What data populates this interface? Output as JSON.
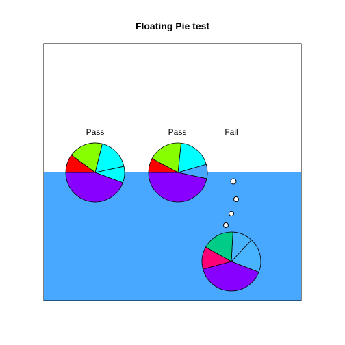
{
  "chart_data": {
    "type": "pie",
    "title": "Floating Pie test",
    "colors": {
      "water": "#48a8ff",
      "background": "#ffffff",
      "frame": "#000000",
      "bubble_fill": "#ffffff"
    },
    "pies": [
      {
        "label": "Pass",
        "state": "floating",
        "slices": [
          {
            "value": 40,
            "color": "#8800ff"
          },
          {
            "value": 8,
            "color": "#00ffff"
          },
          {
            "value": 16,
            "color": "#00ffff"
          },
          {
            "value": 17,
            "color": "#88ff00"
          },
          {
            "value": 9,
            "color": "#ff0000"
          }
        ]
      },
      {
        "label": "Pass",
        "state": "floating",
        "slices": [
          {
            "value": 42,
            "color": "#8800ff"
          },
          {
            "value": 7,
            "color": "#48a8ff"
          },
          {
            "value": 17,
            "color": "#00ffff"
          },
          {
            "value": 17,
            "color": "#88ff00"
          },
          {
            "value": 7,
            "color": "#ff0000"
          }
        ]
      },
      {
        "label": "Fail",
        "state": "sunk",
        "slices": [
          {
            "value": 36,
            "color": "#8800ff"
          },
          {
            "value": 17,
            "color": "#48b4ff"
          },
          {
            "value": 10,
            "color": "#48b4ff"
          },
          {
            "value": 16,
            "color": "#00cc88"
          },
          {
            "value": 11,
            "color": "#ff0077"
          }
        ]
      }
    ]
  }
}
